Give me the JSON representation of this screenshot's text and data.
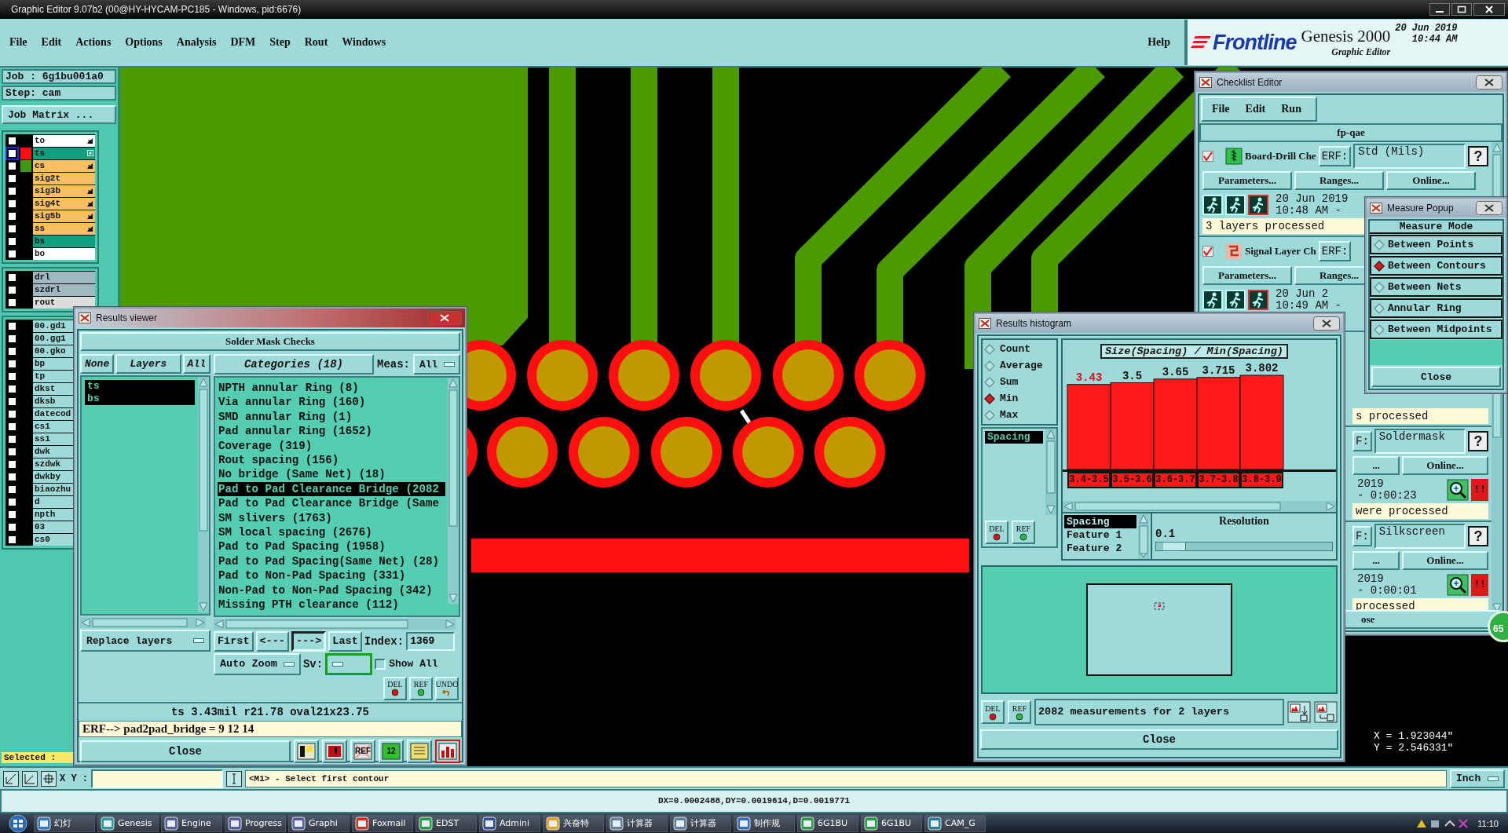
{
  "title_bar": {
    "title": "Graphic Editor 9.07b2 (00@HY-HYCAM-PC185 - Windows, pid:6676)"
  },
  "menu": [
    {
      "label": "File"
    },
    {
      "label": "Edit"
    },
    {
      "label": "Actions"
    },
    {
      "label": "Options"
    },
    {
      "label": "Analysis"
    },
    {
      "label": "DFM"
    },
    {
      "label": "Step"
    },
    {
      "label": "Rout"
    },
    {
      "label": "Windows"
    }
  ],
  "help": "Help",
  "brand": {
    "logo": "Frontline",
    "product": "Genesis 2000",
    "subtitle": "Graphic Editor",
    "date": "20 Jun 2019",
    "time": "10:44 AM"
  },
  "job_panel": {
    "job": "Job :  6g1bu001a0",
    "step": "Step: cam",
    "matrix_button": "Job Matrix ...",
    "selected": "Selected :",
    "layer_groups": [
      [
        {
          "name": "to",
          "color": "#ffffff",
          "checked": false,
          "arrow": true
        },
        {
          "name": "ts",
          "color": "#10a080",
          "checked": false,
          "focused": true,
          "swatch": {
            "color": "#ff1010"
          },
          "expand": true
        },
        {
          "name": "cs",
          "color": "#f8c060",
          "checked": false,
          "swatch": {
            "color": "#3c9a10"
          },
          "arrow": true
        },
        {
          "name": "sig2t",
          "color": "#f8c060",
          "checked": false
        },
        {
          "name": "sig3b",
          "color": "#f8c060",
          "checked": false,
          "arrow": true
        },
        {
          "name": "sig4t",
          "color": "#f8c060",
          "checked": false,
          "arrow": true
        },
        {
          "name": "sig5b",
          "color": "#f8c060",
          "checked": false,
          "arrow": true
        },
        {
          "name": "ss",
          "color": "#f8c060",
          "checked": false,
          "arrow": true
        },
        {
          "name": "bs",
          "color": "#10a080",
          "checked": false
        },
        {
          "name": "bo",
          "color": "#ffffff",
          "checked": false
        }
      ],
      [
        {
          "name": "drl",
          "color": "#a0b8c0",
          "checked": false
        },
        {
          "name": "szdrl",
          "color": "#a0b8c0",
          "checked": false
        },
        {
          "name": "rout",
          "color": "#dcdcdc",
          "checked": false
        }
      ],
      [
        {
          "name": "00.gd1",
          "color": "#9edada",
          "checked": false
        },
        {
          "name": "00.gg1",
          "color": "#9edada",
          "checked": false
        },
        {
          "name": "00.gko",
          "color": "#9edada",
          "checked": false
        },
        {
          "name": "bp",
          "color": "#9edada",
          "checked": false
        },
        {
          "name": "tp",
          "color": "#9edada",
          "checked": false
        },
        {
          "name": "dkst",
          "color": "#9edada",
          "checked": false
        },
        {
          "name": "dksb",
          "color": "#9edada",
          "checked": false
        },
        {
          "name": "datecod",
          "color": "#9edada",
          "checked": false
        },
        {
          "name": "cs1",
          "color": "#9edada",
          "checked": false
        },
        {
          "name": "ss1",
          "color": "#9edada",
          "checked": false
        },
        {
          "name": "dwk",
          "color": "#9edada",
          "checked": false
        },
        {
          "name": "szdwk",
          "color": "#9edada",
          "checked": false
        },
        {
          "name": "dwkby",
          "color": "#9edada",
          "checked": false
        },
        {
          "name": "biaozhu",
          "color": "#9edada",
          "checked": false
        },
        {
          "name": "d",
          "color": "#9edada",
          "checked": false
        },
        {
          "name": "npth",
          "color": "#9edada",
          "checked": false
        },
        {
          "name": "03",
          "color": "#9edada",
          "checked": false
        },
        {
          "name": "cs0",
          "color": "#9edada",
          "checked": false
        }
      ]
    ]
  },
  "results_viewer": {
    "title": "Results viewer",
    "heading": "Solder Mask Checks",
    "layer_buttons": [
      {
        "label": "None"
      },
      {
        "label": "Layers"
      },
      {
        "label": "All"
      }
    ],
    "layers": [
      {
        "label": "ts",
        "selected": true
      },
      {
        "label": "bs",
        "selected": true
      }
    ],
    "replace": "Replace layers",
    "categories_button": "Categories (18)",
    "meas_label": "Meas:",
    "meas_value": "All",
    "categories": [
      {
        "label": "NPTH annular Ring (8)",
        "selected": false
      },
      {
        "label": "Via annular Ring (160)",
        "selected": false
      },
      {
        "label": "SMD annular Ring (1)",
        "selected": false
      },
      {
        "label": "Pad annular Ring (1652)",
        "selected": false
      },
      {
        "label": "Coverage (319)",
        "selected": false
      },
      {
        "label": "Rout spacing (156)",
        "selected": false
      },
      {
        "label": "No bridge (Same Net) (18)",
        "selected": false
      },
      {
        "label": "Pad to Pad Clearance Bridge (2082",
        "selected": true
      },
      {
        "label": "Pad to Pad Clearance Bridge (Same",
        "selected": false
      },
      {
        "label": "SM slivers (1763)",
        "selected": false
      },
      {
        "label": "SM local spacing (2676)",
        "selected": false
      },
      {
        "label": "Pad to Pad Spacing (1958)",
        "selected": false
      },
      {
        "label": "Pad to Pad Spacing(Same Net) (28)",
        "selected": false
      },
      {
        "label": "Pad to Non-Pad Spacing (331)",
        "selected": false
      },
      {
        "label": "Non-Pad to Non-Pad Spacing (342)",
        "selected": false
      },
      {
        "label": "Missing PTH clearance (112)",
        "selected": false
      }
    ],
    "nav": [
      {
        "label": "First",
        "pressed": false
      },
      {
        "label": "<---",
        "pressed": false
      },
      {
        "label": "--->",
        "pressed": true
      },
      {
        "label": "Last",
        "pressed": false
      }
    ],
    "index_label": "Index:",
    "index_value": "1369",
    "zoom_mode": "Auto Zoom",
    "sv_label": "Sv:",
    "show_all": {
      "label": "Show All",
      "checked": false
    },
    "actions": [
      {
        "kind": "del",
        "label": "DEL"
      },
      {
        "kind": "ref",
        "label": "REF"
      },
      {
        "kind": "undo",
        "label": "UNDO"
      }
    ],
    "info": "ts 3.43mil   r21.78   oval21x23.75",
    "erf": "ERF--> pad2pad_bridge = 9  12  14",
    "close": "Close",
    "tools": [
      {
        "kind": "figure",
        "selected": false
      },
      {
        "kind": "layer",
        "selected": false
      },
      {
        "kind": "noref",
        "label": "REF",
        "selected": false
      },
      {
        "kind": "number",
        "label": "12",
        "selected": false
      },
      {
        "kind": "report",
        "selected": false
      },
      {
        "kind": "histogram",
        "selected": true
      }
    ]
  },
  "histogram": {
    "title": "Results histogram",
    "modes": [
      {
        "label": "Count",
        "selected": false
      },
      {
        "label": "Average",
        "selected": false
      },
      {
        "label": "Sum",
        "selected": false
      },
      {
        "label": "Min",
        "selected": true
      },
      {
        "label": "Max",
        "selected": false
      }
    ],
    "attributes": [
      {
        "label": "Spacing",
        "selected": true
      }
    ],
    "list_buttons": [
      {
        "kind": "del",
        "label": "DEL"
      },
      {
        "kind": "ref",
        "label": "REF"
      }
    ],
    "chart_data": {
      "type": "bar",
      "title": "Size(Spacing) / Min(Spacing)",
      "categories": [
        "3.4-3.5",
        "3.5-3.6",
        "3.6-3.7",
        "3.7-3.8",
        "3.8-3.9"
      ],
      "values": [
        3.43,
        3.5,
        3.65,
        3.715,
        3.802
      ],
      "data_labels": true,
      "value_labels": [
        "3.43",
        "3.5",
        "3.65",
        "3.715",
        "3.802"
      ]
    },
    "fields": [
      {
        "label": "Spacing",
        "selected": true
      },
      {
        "label": "Feature 1",
        "selected": false
      },
      {
        "label": "Feature 2",
        "selected": false
      }
    ],
    "resolution_label": "Resolution",
    "resolution_value": "0.1",
    "resolution_slider": {
      "level": 0.04
    },
    "footer_buttons": [
      {
        "kind": "del",
        "label": "DEL"
      },
      {
        "kind": "ref",
        "label": "REF"
      }
    ],
    "summary": "2082 measurements for 2 layers",
    "close": "Close"
  },
  "checklist_editor": {
    "title": "Checklist Editor",
    "menu": [
      {
        "label": "File"
      },
      {
        "label": "Edit"
      },
      {
        "label": "Run"
      }
    ],
    "checklist": "fp-qae",
    "checks": [
      {
        "kind": "full",
        "enabled": true,
        "name": "Board-Drill Che",
        "erf": "ERF:",
        "erf_value": "Std (Mils)",
        "help": "?",
        "buttons": [
          "Parameters...",
          "Ranges...",
          "Online..."
        ],
        "date": "20 Jun 2019",
        "time": "10:48 AM -",
        "status": "3 layers processed"
      },
      {
        "kind": "full",
        "enabled": true,
        "name": "Signal Layer Ch",
        "erf": "ERF:",
        "buttons": [
          "Parameters...",
          "Ranges..."
        ],
        "date": "20 Jun 2",
        "time": "10:49 AM -"
      },
      {
        "kind": "partial",
        "status": "s processed"
      },
      {
        "kind": "partial",
        "erf": "F:",
        "erf_value": "Soldermask",
        "help": "?",
        "buttons": [
          "...",
          "Online..."
        ],
        "date": "2019",
        "time": "- 0:00:23",
        "alert": "!!",
        "status": "were processed"
      },
      {
        "kind": "partial",
        "erf": "F:",
        "erf_value": "Silkscreen",
        "help": "?",
        "buttons": [
          "...",
          "Online..."
        ],
        "date": "2019",
        "time": "- 0:00:01",
        "alert": "!!",
        "status": "processed"
      }
    ],
    "close": "ose"
  },
  "measure_popup": {
    "title": "Measure Popup",
    "heading": "Measure Mode",
    "modes": [
      {
        "label": "Between Points",
        "selected": false
      },
      {
        "label": "Between Contours",
        "selected": true
      },
      {
        "label": "Between Nets",
        "selected": false
      },
      {
        "label": "Annular Ring",
        "selected": false
      },
      {
        "label": "Between Midpoints",
        "selected": false
      }
    ],
    "close": "Close"
  },
  "coordinates": {
    "x": "X = 1.923044\"",
    "y": "Y = 2.546331\""
  },
  "badge": "65",
  "toolbar": {
    "xy_label": "X Y :",
    "message": "<M1> - Select first contour",
    "units": "Inch"
  },
  "status_bar": "DX=0.0002488,DY=0.0019614,D=0.0019771",
  "taskbar": {
    "items": [
      {
        "label": "幻灯"
      },
      {
        "label": "Genesis"
      },
      {
        "label": "Engine"
      },
      {
        "label": "Progress"
      },
      {
        "label": "Graphi"
      },
      {
        "label": "Foxmail"
      },
      {
        "label": "EDST"
      },
      {
        "label": "Admini"
      },
      {
        "label": "兴奋特"
      },
      {
        "label": "计算器"
      },
      {
        "label": "计算器"
      },
      {
        "label": "制作规"
      },
      {
        "label": "6G1BU"
      },
      {
        "label": "6G1BU"
      },
      {
        "label": "CAM_G"
      }
    ],
    "time": "11:10"
  }
}
